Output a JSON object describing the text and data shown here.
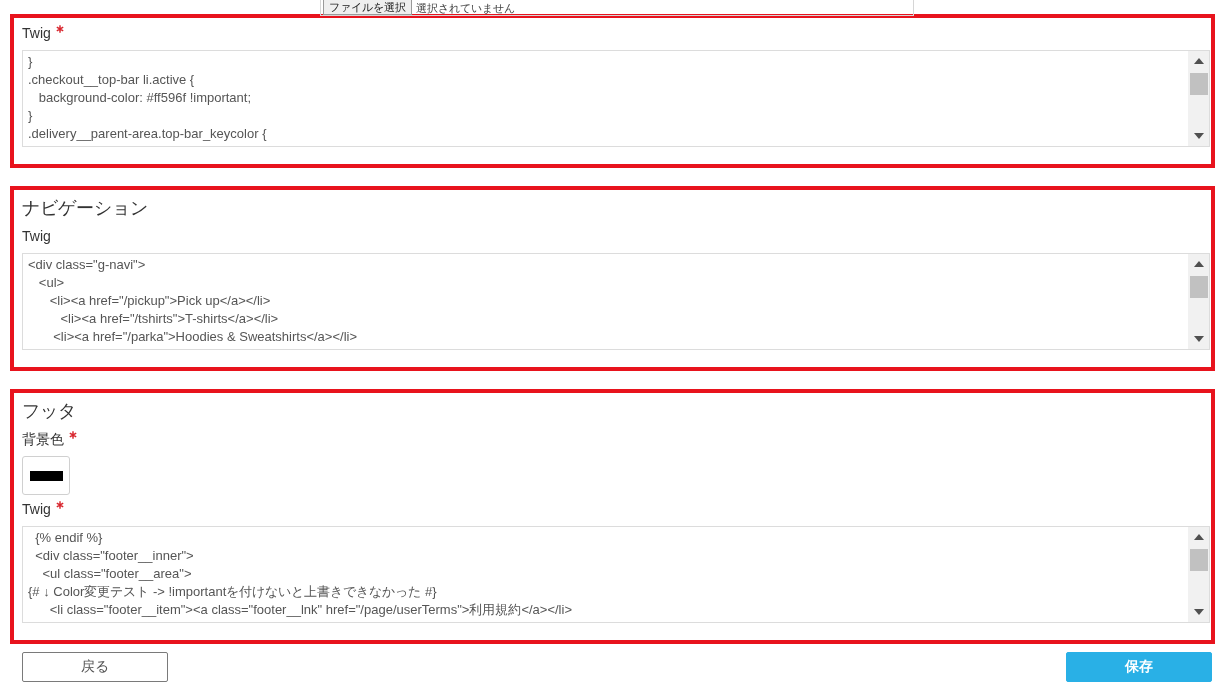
{
  "file_upload": {
    "button": "ファイルを選択",
    "status": "選択されていません"
  },
  "sections": [
    {
      "highlighted": true,
      "fields": [
        {
          "kind": "code",
          "label": "Twig",
          "required": true,
          "lines": [
            "}",
            ".checkout__top-bar li.active {",
            "   background-color: #ff596f !important;",
            "}",
            ".delivery__parent-area.top-bar_keycolor {"
          ]
        }
      ]
    },
    {
      "highlighted": true,
      "heading": "ナビゲーション",
      "fields": [
        {
          "kind": "code",
          "label": "Twig",
          "required": false,
          "lines": [
            "<div class=\"g-navi\">",
            "   <ul>",
            "      <li><a href=\"/pickup\">Pick up</a></li>",
            "         <li><a href=\"/tshirts\">T-shirts</a></li>",
            "       <li><a href=\"/parka\">Hoodies & Sweatshirts</a></li>"
          ]
        }
      ]
    },
    {
      "highlighted": true,
      "heading": "フッタ",
      "fields": [
        {
          "kind": "color",
          "label": "背景色",
          "required": true,
          "color": "#000000"
        },
        {
          "kind": "code",
          "label": "Twig",
          "required": true,
          "lines": [
            "  {% endif %}",
            "  <div class=\"footer__inner\">",
            "    <ul class=\"footer__area\">",
            "{# ↓ Color変更テスト -> !importantを付けないと上書きできなかった #}",
            "      <li class=\"footer__item\"><a class=\"footer__lnk\" href=\"/page/userTerms\">利用規約</a></li>"
          ]
        }
      ]
    }
  ],
  "buttons": [
    {
      "kind": "secondary",
      "label": "戻る"
    },
    {
      "kind": "primary",
      "label": "保存"
    }
  ]
}
